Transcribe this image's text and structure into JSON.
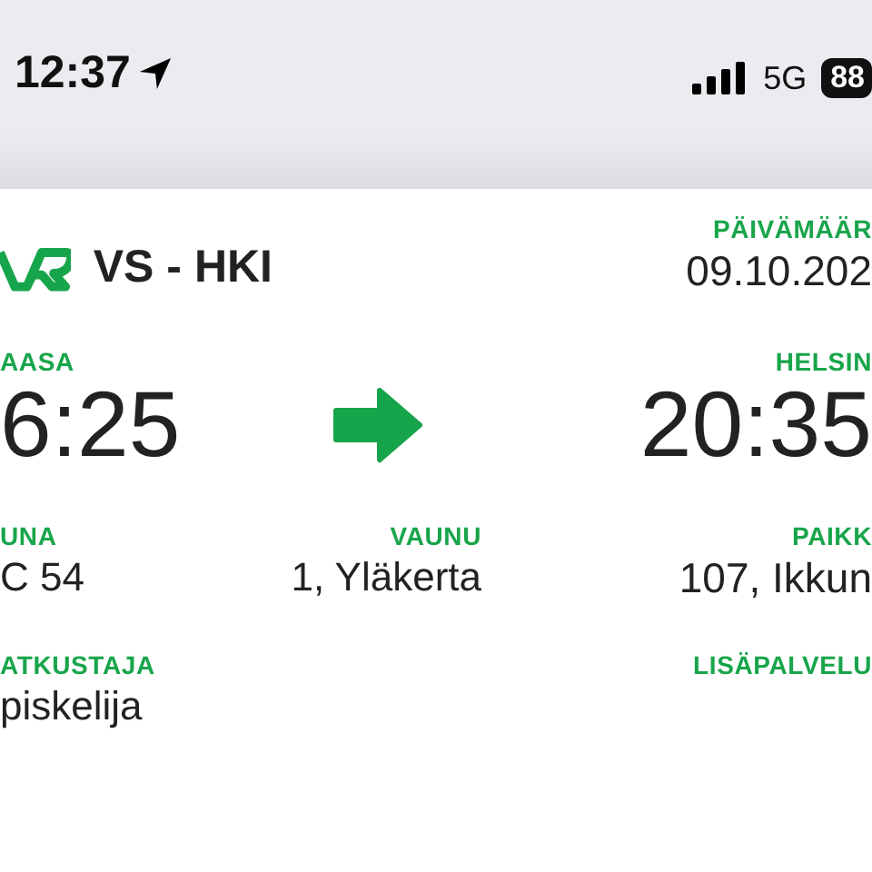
{
  "status_bar": {
    "time": "12:37",
    "network": "5G",
    "battery": "88"
  },
  "header": {
    "title": "VS - HKI",
    "date_label": "PÄIVÄMÄÄR",
    "date": "09.10.202"
  },
  "journey": {
    "from_label": "AASA",
    "departure": "6:25",
    "to_label": "HELSIN",
    "arrival": "20:35"
  },
  "detail_rows": [
    {
      "left": {
        "label": "UNA",
        "value": "C 54"
      },
      "middle": {
        "label": "VAUNU",
        "value": "1, Yläkerta"
      },
      "right": {
        "label": "PAIKK",
        "value": "107, Ikkun"
      }
    },
    {
      "left": {
        "label": "ATKUSTAJA",
        "value": "piskelija"
      },
      "right": {
        "label": "LISÄPALVELU"
      }
    }
  ]
}
